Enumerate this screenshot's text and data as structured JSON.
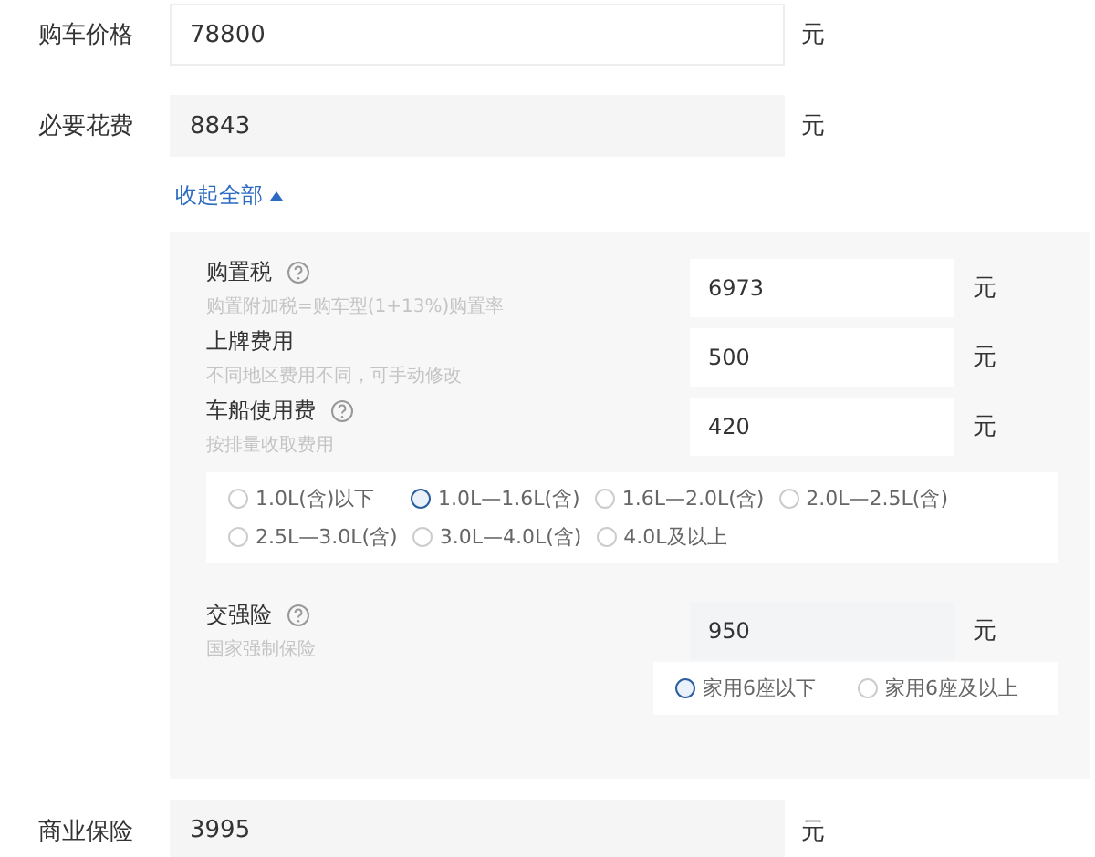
{
  "price": {
    "label": "购车价格",
    "value": "78800",
    "unit": "元",
    "kind": "input"
  },
  "required": {
    "label": "必要花费",
    "value": "8843",
    "unit": "元",
    "kind": "total"
  },
  "toggle": {
    "label": "收起全部",
    "expanded": true
  },
  "details": [
    {
      "label": "购置税",
      "help": true,
      "hint": "购置附加税=购车型(1+13%)购置率",
      "value": "6973",
      "unit": "元"
    },
    {
      "label": "上牌费用",
      "help": false,
      "hint": "不同地区费用不同，可手动修改",
      "value": "500",
      "unit": "元"
    },
    {
      "label": "车船使用费",
      "help": true,
      "hint": "按排量收取费用",
      "value": "420",
      "unit": "元",
      "options": [
        {
          "label": "1.0L(含)以下",
          "selected": false
        },
        {
          "label": "1.0L—1.6L(含)",
          "selected": true
        },
        {
          "label": "1.6L—2.0L(含)",
          "selected": false
        },
        {
          "label": "2.0L—2.5L(含)",
          "selected": false
        },
        {
          "label": "2.5L—3.0L(含)",
          "selected": false
        },
        {
          "label": "3.0L—4.0L(含)",
          "selected": false
        },
        {
          "label": "4.0L及以上",
          "selected": false
        }
      ]
    },
    {
      "label": "交强险",
      "help": true,
      "hint": "国家强制保险",
      "value": "950",
      "unit": "元",
      "options": [
        {
          "label": "家用6座以下",
          "selected": true
        },
        {
          "label": "家用6座及以上",
          "selected": false
        }
      ]
    }
  ],
  "commercial": {
    "label": "商业保险",
    "value": "3995",
    "unit": "元",
    "kind": "total"
  }
}
